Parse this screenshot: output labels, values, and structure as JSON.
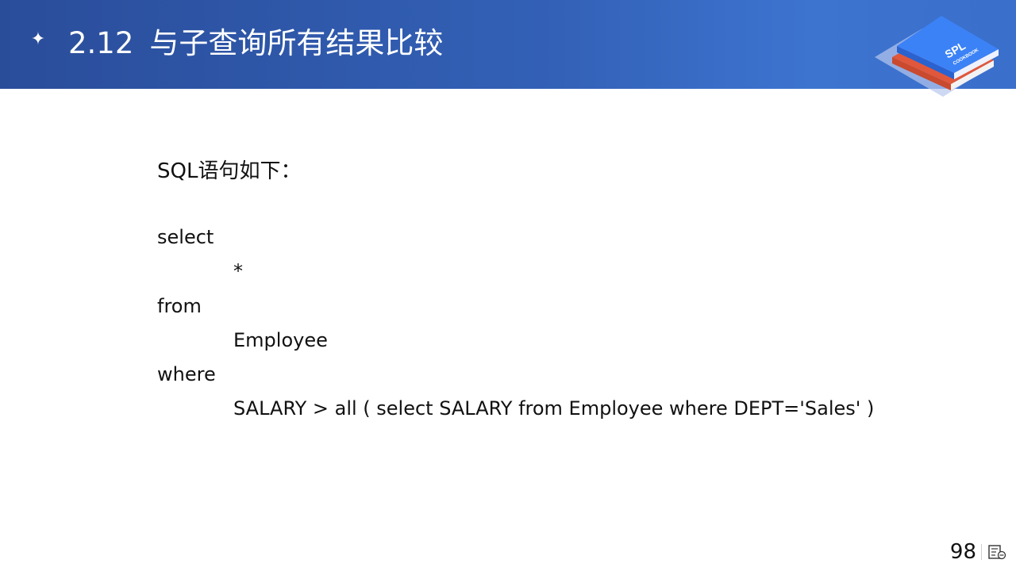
{
  "header": {
    "bullet_icon": "four-point-star-icon",
    "section_number": "2.12",
    "title": "与子查询所有结果比较",
    "logo": {
      "name": "spl-cookbook-logo",
      "main_text": "SPL",
      "sub_text": "COOKBOOK",
      "colors": {
        "top_book": "#3b82f6",
        "bottom_book": "#e0573c",
        "shadow": "#b8c8ee"
      }
    }
  },
  "content": {
    "intro": "SQL语句如下：",
    "code_lines": [
      "select",
      "*",
      "from",
      "Employee",
      "where",
      "SALARY > all ( select SALARY from Employee where DEPT='Sales' )"
    ]
  },
  "footer": {
    "page_number": "98",
    "notes_icon": "slide-notes-icon"
  }
}
